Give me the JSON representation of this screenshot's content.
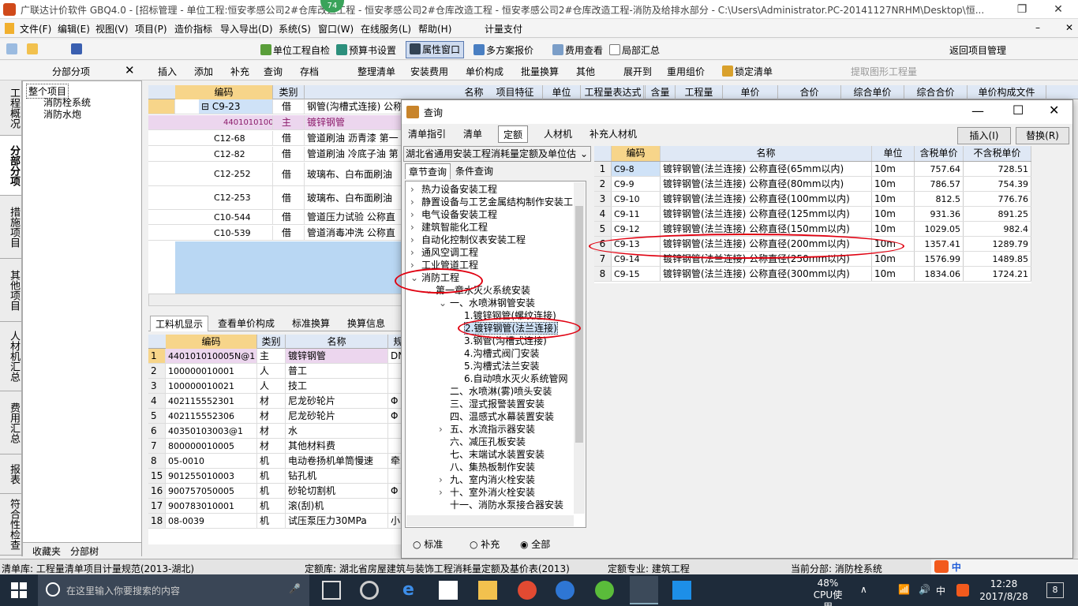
{
  "titlebar": {
    "title": "广联达计价软件 GBQ4.0 - [招标管理 - 单位工程:恒安孝感公司2#仓库改造工程 - 恒安孝感公司2#仓库改造工程 - 恒安孝感公司2#仓库改造工程-消防及给排水部分 - C:\\Users\\Administrator.PC-20141127NRHM\\Desktop\\恒...",
    "badge": "74"
  },
  "menu": [
    "文件(F)",
    "编辑(E)",
    "视图(V)",
    "项目(P)",
    "造价指标",
    "导入导出(D)",
    "系统(S)",
    "窗口(W)",
    "在线服务(L)",
    "帮助(H)",
    "计量支付"
  ],
  "toolbar1": {
    "self_check": "单位工程自检",
    "budget_settings": "预算书设置",
    "property_window": "属性窗口",
    "multi_scheme": "多方案报价",
    "fee_view": "费用查看",
    "local_summary": "局部汇总",
    "return_project": "返回项目管理"
  },
  "toolbar2": [
    "插入",
    "添加",
    "补充",
    "查询",
    "存档",
    "整理清单",
    "安装费用",
    "单价构成",
    "批量换算",
    "其他",
    "展开到",
    "重用组价",
    "锁定清单",
    "提取图形工程量"
  ],
  "left_panel": {
    "title": "分部分项",
    "tabs": [
      "工程概况",
      "分部分项",
      "措施项目",
      "其他项目",
      "人材机汇总",
      "费用汇总",
      "报表",
      "符合性检查"
    ],
    "tree": [
      "整个项目",
      "消防栓系统",
      "消防水炮"
    ],
    "bottom_tabs": [
      "收藏夹",
      "分部树"
    ]
  },
  "main_grid": {
    "headers": [
      "编码",
      "类别",
      "名称",
      "项目特征",
      "单位",
      "工程量表达式",
      "含量",
      "工程量",
      "单价",
      "合价",
      "综合单价",
      "综合合价",
      "单价构成文件"
    ],
    "rows": [
      {
        "code": "C9-23",
        "type": "借",
        "name": "钢管(沟槽式连接) 公称"
      },
      {
        "code": "4401010100",
        "type": "主",
        "name": "镀锌钢管"
      },
      {
        "code": "C12-68",
        "type": "借",
        "name": "管道刷油 沥青漆 第一"
      },
      {
        "code": "C12-82",
        "type": "借",
        "name": "管道刷油 冷底子油 第"
      },
      {
        "code": "C12-252",
        "type": "借",
        "name": "玻璃布、白布面刷油"
      },
      {
        "code": "C12-253",
        "type": "借",
        "name": "玻璃布、白布面刷油"
      },
      {
        "code": "C10-544",
        "type": "借",
        "name": "管道压力试验 公称直"
      },
      {
        "code": "C10-539",
        "type": "借",
        "name": "管道消毒冲洗 公称直"
      }
    ]
  },
  "sub_tabs": [
    "工料机显示",
    "查看单价构成",
    "标准换算",
    "换算信息"
  ],
  "lower_grid": {
    "headers": [
      "编码",
      "类别",
      "名称",
      "规"
    ],
    "rows": [
      {
        "n": "1",
        "code": "440101010005N@1",
        "type": "主",
        "name": "镀锌钢管",
        "spec": "DN"
      },
      {
        "n": "2",
        "code": "100000010001",
        "type": "人",
        "name": "普工",
        "spec": ""
      },
      {
        "n": "3",
        "code": "100000010021",
        "type": "人",
        "name": "技工",
        "spec": ""
      },
      {
        "n": "4",
        "code": "402115552301",
        "type": "材",
        "name": "尼龙砂轮片",
        "spec": "Φ"
      },
      {
        "n": "5",
        "code": "402115552306",
        "type": "材",
        "name": "尼龙砂轮片",
        "spec": "Φ"
      },
      {
        "n": "6",
        "code": "40350103003@1",
        "type": "材",
        "name": "水",
        "spec": ""
      },
      {
        "n": "7",
        "code": "800000010005",
        "type": "材",
        "name": "其他材料费",
        "spec": ""
      },
      {
        "n": "8",
        "code": "05-0010",
        "type": "机",
        "name": "电动卷扬机单筒慢速",
        "spec": "牵"
      },
      {
        "n": "15",
        "code": "901255010003",
        "type": "机",
        "name": "钻孔机",
        "spec": ""
      },
      {
        "n": "16",
        "code": "900757050005",
        "type": "机",
        "name": "砂轮切割机",
        "spec": "Φ"
      },
      {
        "n": "17",
        "code": "900783010001",
        "type": "机",
        "name": "滚(刮)机",
        "spec": ""
      },
      {
        "n": "18",
        "code": "08-0039",
        "type": "机",
        "name": "试压泵压力30MPa",
        "spec": "小"
      }
    ]
  },
  "dialog": {
    "title": "查询",
    "tabs": [
      "清单指引",
      "清单",
      "定额",
      "人材机",
      "补充人材机"
    ],
    "insert_button": "插入(I)",
    "replace_button": "替换(R)",
    "quota_lib": "湖北省通用安装工程消耗量定额及单位估",
    "query_tabs": [
      "章节查询",
      "条件查询"
    ],
    "tree": [
      {
        "t": "热力设备安装工程",
        "l": 0,
        "e": ">"
      },
      {
        "t": "静置设备与工艺金属结构制作安装工",
        "l": 0,
        "e": ">"
      },
      {
        "t": "电气设备安装工程",
        "l": 0,
        "e": ">"
      },
      {
        "t": "建筑智能化工程",
        "l": 0,
        "e": ">"
      },
      {
        "t": "自动化控制仪表安装工程",
        "l": 0,
        "e": ">"
      },
      {
        "t": "通风空调工程",
        "l": 0,
        "e": ">"
      },
      {
        "t": "工业管道工程",
        "l": 0,
        "e": ">"
      },
      {
        "t": "消防工程",
        "l": 0,
        "e": "v"
      },
      {
        "t": "第一章水灭火系统安装",
        "l": 1,
        "e": "v"
      },
      {
        "t": "一、水喷淋钢管安装",
        "l": 2,
        "e": "v"
      },
      {
        "t": "1.镀锌钢管(螺纹连接)",
        "l": 3,
        "e": ""
      },
      {
        "t": "2.镀锌钢管(法兰连接)",
        "l": 3,
        "e": ""
      },
      {
        "t": "3.钢管(沟槽式连接)",
        "l": 3,
        "e": ""
      },
      {
        "t": "4.沟槽式阀门安装",
        "l": 3,
        "e": ""
      },
      {
        "t": "5.沟槽式法兰安装",
        "l": 3,
        "e": ""
      },
      {
        "t": "6.自动喷水灭火系统管网",
        "l": 3,
        "e": ""
      },
      {
        "t": "二、水喷淋(雾)喷头安装",
        "l": 2,
        "e": ""
      },
      {
        "t": "三、湿式报警装置安装",
        "l": 2,
        "e": ""
      },
      {
        "t": "四、温感式水幕装置安装",
        "l": 2,
        "e": ""
      },
      {
        "t": "五、水流指示器安装",
        "l": 2,
        "e": ">"
      },
      {
        "t": "六、减压孔板安装",
        "l": 2,
        "e": ""
      },
      {
        "t": "七、末端试水装置安装",
        "l": 2,
        "e": ""
      },
      {
        "t": "八、集热板制作安装",
        "l": 2,
        "e": ""
      },
      {
        "t": "九、室内消火栓安装",
        "l": 2,
        "e": ">"
      },
      {
        "t": "十、室外消火栓安装",
        "l": 2,
        "e": ">"
      },
      {
        "t": "十一、消防水泵接合器安装",
        "l": 2,
        "e": ""
      }
    ],
    "radios": [
      "标准",
      "补充",
      "全部"
    ],
    "result_headers": [
      "编码",
      "名称",
      "单位",
      "含税单价",
      "不含税单价"
    ],
    "results": [
      {
        "n": "1",
        "code": "C9-8",
        "name": "镀锌钢管(法兰连接) 公称直径(65mm以内)",
        "unit": "10m",
        "tax": "757.64",
        "notax": "728.51"
      },
      {
        "n": "2",
        "code": "C9-9",
        "name": "镀锌钢管(法兰连接) 公称直径(80mm以内)",
        "unit": "10m",
        "tax": "786.57",
        "notax": "754.39"
      },
      {
        "n": "3",
        "code": "C9-10",
        "name": "镀锌钢管(法兰连接) 公称直径(100mm以内)",
        "unit": "10m",
        "tax": "812.5",
        "notax": "776.76"
      },
      {
        "n": "4",
        "code": "C9-11",
        "name": "镀锌钢管(法兰连接) 公称直径(125mm以内)",
        "unit": "10m",
        "tax": "931.36",
        "notax": "891.25"
      },
      {
        "n": "5",
        "code": "C9-12",
        "name": "镀锌钢管(法兰连接) 公称直径(150mm以内)",
        "unit": "10m",
        "tax": "1029.05",
        "notax": "982.4"
      },
      {
        "n": "6",
        "code": "C9-13",
        "name": "镀锌钢管(法兰连接) 公称直径(200mm以内)",
        "unit": "10m",
        "tax": "1357.41",
        "notax": "1289.79"
      },
      {
        "n": "7",
        "code": "C9-14",
        "name": "镀锌钢管(法兰连接) 公称直径(250mm以内)",
        "unit": "10m",
        "tax": "1576.99",
        "notax": "1489.85"
      },
      {
        "n": "8",
        "code": "C9-15",
        "name": "镀锌钢管(法兰连接) 公称直径(300mm以内)",
        "unit": "10m",
        "tax": "1834.06",
        "notax": "1724.21"
      }
    ]
  },
  "statusbar": {
    "list_lib": "清单库: 工程量清单项目计量规范(2013-湖北)",
    "quota_lib": "定额库: 湖北省房屋建筑与装饰工程消耗量定额及基价表(2013)",
    "quota_major": "定额专业: 建筑工程",
    "current_section": "当前分部: 消防栓系统",
    "ime": "中"
  },
  "taskbar": {
    "search_placeholder": "在这里输入你要搜索的内容",
    "cpu": "48%",
    "cpu_label": "CPU使用",
    "ime": "中",
    "time": "12:28",
    "date": "2017/8/28",
    "notify": "8"
  }
}
